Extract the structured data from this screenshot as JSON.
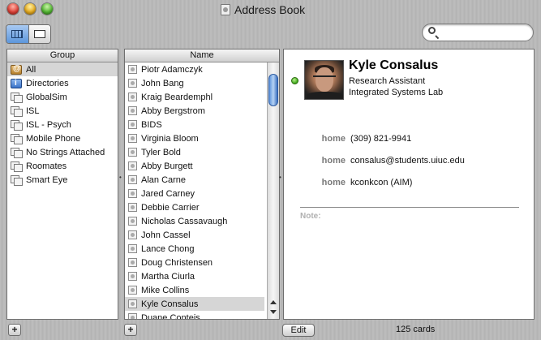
{
  "window": {
    "title": "Address Book"
  },
  "search": {
    "placeholder": "",
    "value": ""
  },
  "groups": {
    "header": "Group",
    "items": [
      {
        "label": "All",
        "icon": "all-icon",
        "selected": true
      },
      {
        "label": "Directories",
        "icon": "directories-icon"
      },
      {
        "label": "GlobalSim",
        "icon": "group-icon"
      },
      {
        "label": "ISL",
        "icon": "group-icon"
      },
      {
        "label": "ISL - Psych",
        "icon": "group-icon"
      },
      {
        "label": "Mobile Phone",
        "icon": "group-icon"
      },
      {
        "label": "No Strings Attached",
        "icon": "group-icon"
      },
      {
        "label": "Roomates",
        "icon": "group-icon"
      },
      {
        "label": "Smart Eye",
        "icon": "group-icon"
      }
    ]
  },
  "names": {
    "header": "Name",
    "items": [
      "Piotr Adamczyk",
      "John Bang",
      "Kraig Beardemphl",
      "Abby Bergstrom",
      "BIDS",
      "Virginia Bloom",
      "Tyler Bold",
      "Abby Burgett",
      "Alan Carne",
      "Jared Carney",
      "Debbie Carrier",
      "Nicholas Cassavaugh",
      "John Cassel",
      "Lance Chong",
      "Doug Christensen",
      "Martha Ciurla",
      "Mike Collins",
      "Kyle Consalus",
      "Duane Conteis"
    ],
    "selected": "Kyle Consalus"
  },
  "card": {
    "name": "Kyle Consalus",
    "title": "Research Assistant",
    "organization": "Integrated Systems Lab",
    "status_color": "#3aa415",
    "fields": [
      {
        "label": "home",
        "value": "(309) 821-9941"
      },
      {
        "label": "home",
        "value": "consalus@students.uiuc.edu"
      },
      {
        "label": "home",
        "value": "kconkcon (AIM)"
      }
    ],
    "note_label": "Note:"
  },
  "footer": {
    "add_group": "+",
    "add_person": "+",
    "edit_label": "Edit",
    "count": "125 cards"
  }
}
